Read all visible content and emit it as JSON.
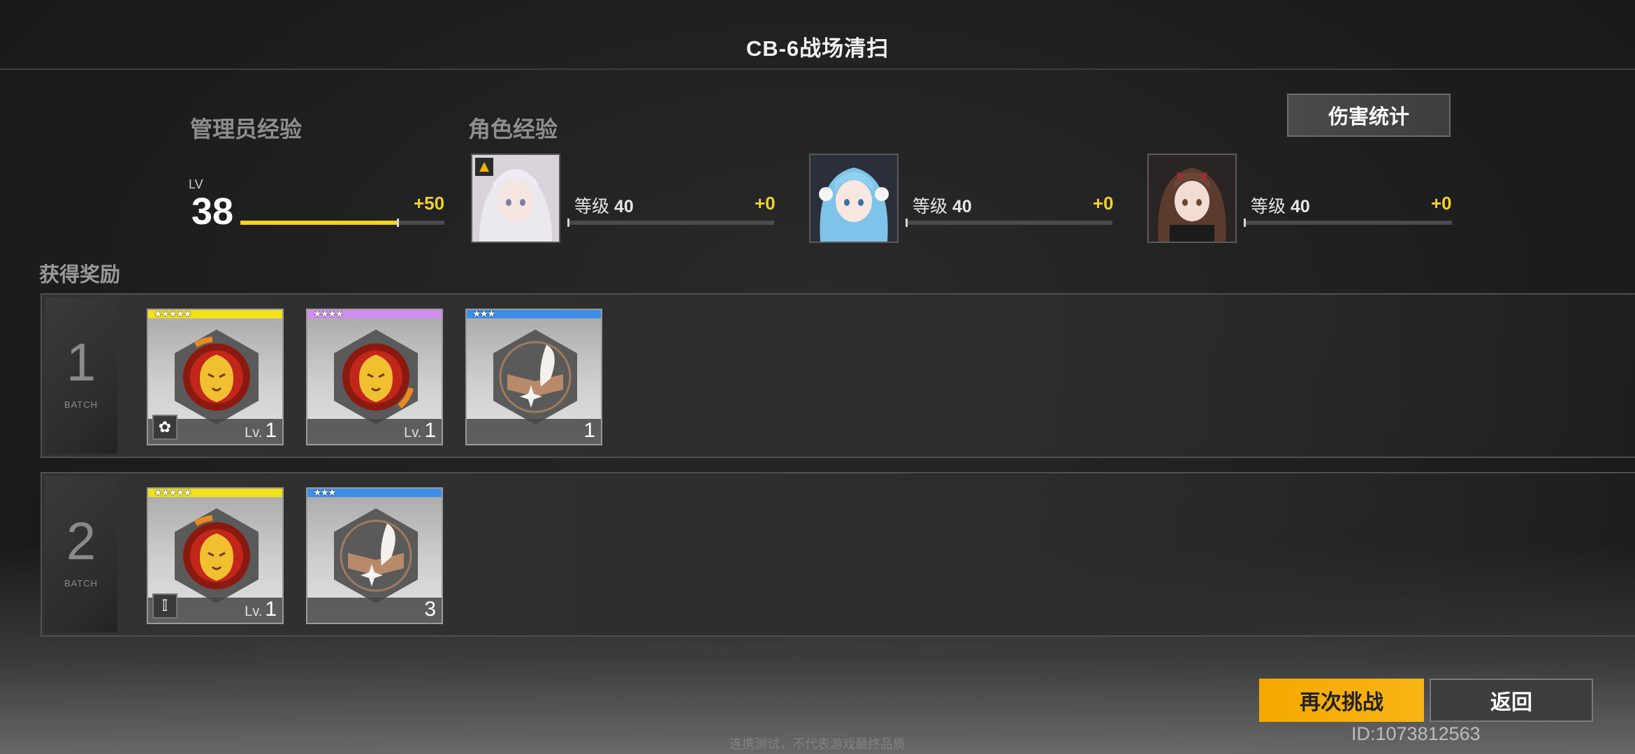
{
  "title": "CB-6战场清扫",
  "admin_exp": {
    "label": "管理员经验",
    "lv_tag": "LV",
    "level": "38",
    "gain": "+50",
    "progress": 0.77
  },
  "char_exp": {
    "label": "角色经验",
    "characters": [
      {
        "level_label": "等级",
        "level": "40",
        "gain": "+0",
        "progress": 0.0
      },
      {
        "level_label": "等级",
        "level": "40",
        "gain": "+0",
        "progress": 0.0
      },
      {
        "level_label": "等级",
        "level": "40",
        "gain": "+0",
        "progress": 0.0
      }
    ]
  },
  "damage_stats_button": "伤害统计",
  "rewards_label": "获得奖励",
  "batches": [
    {
      "number": "1",
      "word": "BATCH",
      "items": [
        {
          "stars": "★★★★★",
          "rarity_color": "#f1e21a",
          "foot_prefix": "Lv.",
          "foot_value": "1",
          "icon": "lion-chip-icon",
          "badge": "✿"
        },
        {
          "stars": "★★★★",
          "rarity_color": "#d08ef0",
          "foot_prefix": "Lv.",
          "foot_value": "1",
          "icon": "lion-chip-icon",
          "badge": ""
        },
        {
          "stars": "★★★",
          "rarity_color": "#3b8fe8",
          "foot_prefix": "",
          "foot_value": "1",
          "icon": "feather-book-icon",
          "badge": ""
        }
      ]
    },
    {
      "number": "2",
      "word": "BATCH",
      "items": [
        {
          "stars": "★★★★★",
          "rarity_color": "#f1e21a",
          "foot_prefix": "Lv.",
          "foot_value": "1",
          "icon": "lion-chip-icon",
          "badge": "𝕀"
        },
        {
          "stars": "★★★",
          "rarity_color": "#3b8fe8",
          "foot_prefix": "",
          "foot_value": "3",
          "icon": "feather-book-icon",
          "badge": ""
        }
      ]
    }
  ],
  "retry_button": "再次挑战",
  "back_button": "返回",
  "uid": "ID:1073812563",
  "footnote": "连携测试，不代表游戏最终品质"
}
